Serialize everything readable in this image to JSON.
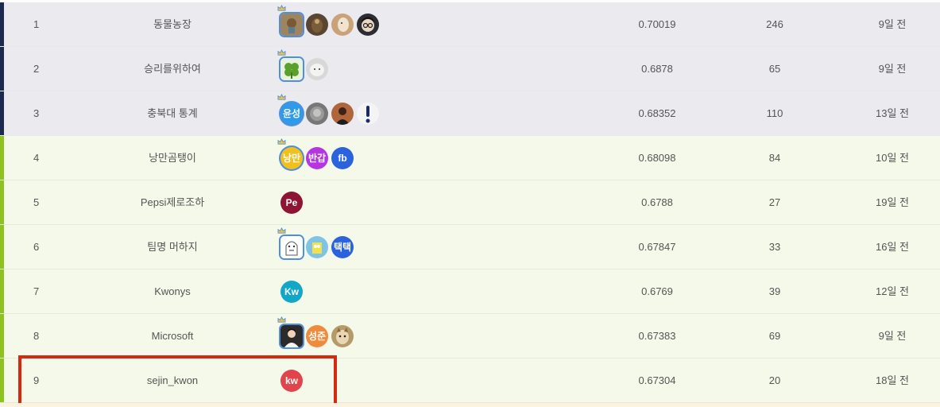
{
  "rows": [
    {
      "rank": "1",
      "team": "동물농장",
      "score": "0.70019",
      "subs": "246",
      "date": "9일 전",
      "tier": "top",
      "members": [
        {
          "kind": "img",
          "icon": "bear-photo-icon",
          "leader": true,
          "bg": "#9c8560"
        },
        {
          "kind": "img",
          "icon": "bird-photo-icon",
          "bg": "#5a4630"
        },
        {
          "kind": "img",
          "icon": "doll-photo-icon",
          "bg": "#c9a27a"
        },
        {
          "kind": "img",
          "icon": "anime-face-icon",
          "bg": "#2c2c33"
        }
      ]
    },
    {
      "rank": "2",
      "team": "승리를위하여",
      "score": "0.6878",
      "subs": "65",
      "date": "9일 전",
      "tier": "top",
      "members": [
        {
          "kind": "img",
          "icon": "clover-icon",
          "leader": true,
          "bg": "#e9f2dc"
        },
        {
          "kind": "img",
          "icon": "white-dog-photo-icon",
          "bg": "#d8d8d8"
        }
      ]
    },
    {
      "rank": "3",
      "team": "충북대 통계",
      "score": "0.68352",
      "subs": "110",
      "date": "13일 전",
      "tier": "top",
      "members": [
        {
          "kind": "text",
          "label": "윤성",
          "leader": true,
          "bg": "#2e9be8"
        },
        {
          "kind": "img",
          "icon": "grey-photo-icon",
          "bg": "#777777"
        },
        {
          "kind": "img",
          "icon": "person-photo-icon",
          "bg": "#b0663a"
        },
        {
          "kind": "img",
          "icon": "exclamation-icon",
          "bg": "#f4f4f4"
        }
      ]
    },
    {
      "rank": "4",
      "team": "낭만곰탱이",
      "score": "0.68098",
      "subs": "84",
      "date": "10일 전",
      "tier": "mid",
      "members": [
        {
          "kind": "text",
          "label": "낭만",
          "leader": true,
          "bg": "#f2c01c"
        },
        {
          "kind": "text",
          "label": "반갑",
          "bg": "#b536e0"
        },
        {
          "kind": "text",
          "label": "fb",
          "bg": "#2b63dd"
        }
      ]
    },
    {
      "rank": "5",
      "team": "Pepsi제로조하",
      "score": "0.6788",
      "subs": "27",
      "date": "19일 전",
      "tier": "mid",
      "members": [
        {
          "kind": "text",
          "label": "Pe",
          "bg": "#8e1436"
        }
      ]
    },
    {
      "rank": "6",
      "team": "팀명 머하지",
      "score": "0.67847",
      "subs": "33",
      "date": "16일 전",
      "tier": "mid",
      "members": [
        {
          "kind": "img",
          "icon": "ghost-drawing-icon",
          "leader": true,
          "bg": "#ffffff"
        },
        {
          "kind": "img",
          "icon": "sponge-character-icon",
          "bg": "#7fc3e8"
        },
        {
          "kind": "text",
          "label": "택택",
          "bg": "#2b63dd"
        }
      ]
    },
    {
      "rank": "7",
      "team": "Kwonys",
      "score": "0.6769",
      "subs": "39",
      "date": "12일 전",
      "tier": "mid",
      "members": [
        {
          "kind": "text",
          "label": "Kw",
          "bg": "#13a7c7"
        }
      ]
    },
    {
      "rank": "8",
      "team": "Microsoft",
      "score": "0.67383",
      "subs": "69",
      "date": "9일 전",
      "tier": "mid",
      "members": [
        {
          "kind": "img",
          "icon": "person-portrait-icon",
          "leader": true,
          "bg": "#2b2b2b"
        },
        {
          "kind": "text",
          "label": "성준",
          "bg": "#f08a3c"
        },
        {
          "kind": "img",
          "icon": "cat-photo-icon",
          "bg": "#b59a6a"
        }
      ]
    },
    {
      "rank": "9",
      "team": "sejin_kwon",
      "score": "0.67304",
      "subs": "20",
      "date": "18일 전",
      "tier": "mid",
      "members": [
        {
          "kind": "text",
          "label": "kw",
          "bg": "#e0444c"
        }
      ]
    }
  ],
  "colors": {
    "top_row_bg": "#eaeaef",
    "top_bar": "#1b2a4e",
    "mid_row_bg": "#f5f9ea",
    "mid_bar": "#8dc21f",
    "highlight": "#d52a10",
    "leader_ring": "#4f8fe0"
  }
}
